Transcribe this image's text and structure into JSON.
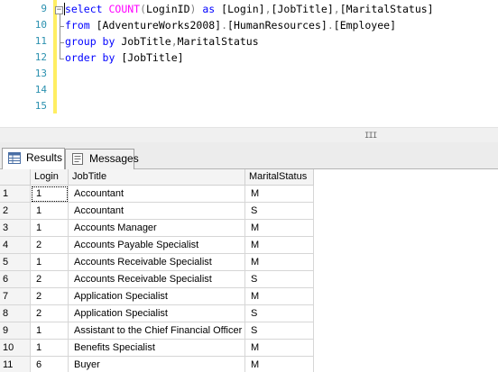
{
  "editor": {
    "line_numbers": [
      "9",
      "10",
      "11",
      "12",
      "13",
      "14",
      "15"
    ],
    "lines": [
      [
        {
          "t": "select ",
          "c": "kw"
        },
        {
          "t": "COUNT",
          "c": "fn"
        },
        {
          "t": "(",
          "c": "gr"
        },
        {
          "t": "LoginID",
          "c": "id"
        },
        {
          "t": ")",
          "c": "gr"
        },
        {
          "t": " as ",
          "c": "kw"
        },
        {
          "t": "[Login]",
          "c": "id"
        },
        {
          "t": ",",
          "c": "gr"
        },
        {
          "t": "[JobTitle]",
          "c": "id"
        },
        {
          "t": ",",
          "c": "gr"
        },
        {
          "t": "[MaritalStatus]",
          "c": "id"
        }
      ],
      [
        {
          "t": "from ",
          "c": "kw"
        },
        {
          "t": "[AdventureWorks2008]",
          "c": "id"
        },
        {
          "t": ".",
          "c": "gr"
        },
        {
          "t": "[HumanResources]",
          "c": "id"
        },
        {
          "t": ".",
          "c": "gr"
        },
        {
          "t": "[Employee]",
          "c": "id"
        }
      ],
      [
        {
          "t": "group by ",
          "c": "kw"
        },
        {
          "t": "JobTitle",
          "c": "id"
        },
        {
          "t": ",",
          "c": "gr"
        },
        {
          "t": "MaritalStatus",
          "c": "id"
        }
      ],
      [
        {
          "t": "order by ",
          "c": "kw"
        },
        {
          "t": "[JobTitle]",
          "c": "id"
        }
      ],
      [],
      [],
      []
    ],
    "scroll_grip": "III"
  },
  "tabs": [
    {
      "label": "Results",
      "icon": "grid-icon",
      "active": true
    },
    {
      "label": "Messages",
      "icon": "messages-icon",
      "active": false
    }
  ],
  "grid": {
    "columns": [
      "",
      "Login",
      "JobTitle",
      "MaritalStatus"
    ],
    "rows": [
      [
        "1",
        "1",
        "Accountant",
        "M"
      ],
      [
        "2",
        "1",
        "Accountant",
        "S"
      ],
      [
        "3",
        "1",
        "Accounts Manager",
        "M"
      ],
      [
        "4",
        "2",
        "Accounts Payable Specialist",
        "M"
      ],
      [
        "5",
        "1",
        "Accounts Receivable Specialist",
        "M"
      ],
      [
        "6",
        "2",
        "Accounts Receivable Specialist",
        "S"
      ],
      [
        "7",
        "2",
        "Application Specialist",
        "M"
      ],
      [
        "8",
        "2",
        "Application Specialist",
        "S"
      ],
      [
        "9",
        "1",
        "Assistant to the Chief Financial Officer",
        "S"
      ],
      [
        "10",
        "1",
        "Benefits Specialist",
        "M"
      ],
      [
        "11",
        "6",
        "Buyer",
        "M"
      ]
    ]
  }
}
